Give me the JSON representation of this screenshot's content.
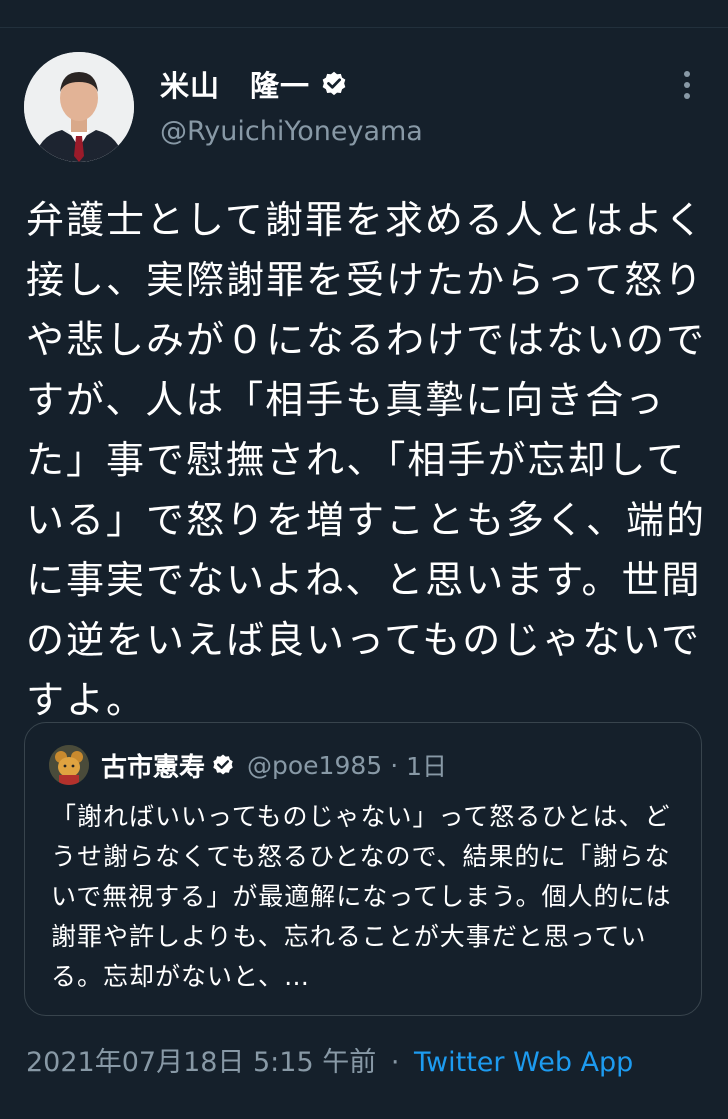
{
  "tweet": {
    "author": {
      "display_name": "米山　隆一",
      "handle": "@RyuichiYoneyama",
      "verified": true,
      "avatar_icon": "person-avatar-icon",
      "menu_icon": "more-vertical-icon"
    },
    "text": "弁護士として謝罪を求める人とはよく接し、実際謝罪を受けたからって怒りや悲しみが０になるわけではないのですが、人は「相手も真摯に向き合った」事で慰撫され、「相手が忘却している」で怒りを増すことも多く、端的に事実でないよね、と思います。世間の逆をいえば良いってものじゃないですよ。",
    "quoted": {
      "display_name": "古市憲寿",
      "handle": "@poe1985",
      "separator": "·",
      "time": "1日",
      "verified": true,
      "text": "「謝ればいいってものじゃない」って怒るひとは、どうせ謝らなくても怒るひとなので、結果的に「謝らないで無視する」が最適解になってしまう。個人的には謝罪や許しよりも、忘れることが大事だと思っている。忘却がないと、…"
    },
    "meta": {
      "date": "2021年07月18日 5:15 午前",
      "separator": "·",
      "source": "Twitter Web App"
    }
  },
  "colors": {
    "background": "#15202b",
    "secondary_text": "#8899a6",
    "link": "#1d9bf0",
    "border": "#38444d"
  }
}
